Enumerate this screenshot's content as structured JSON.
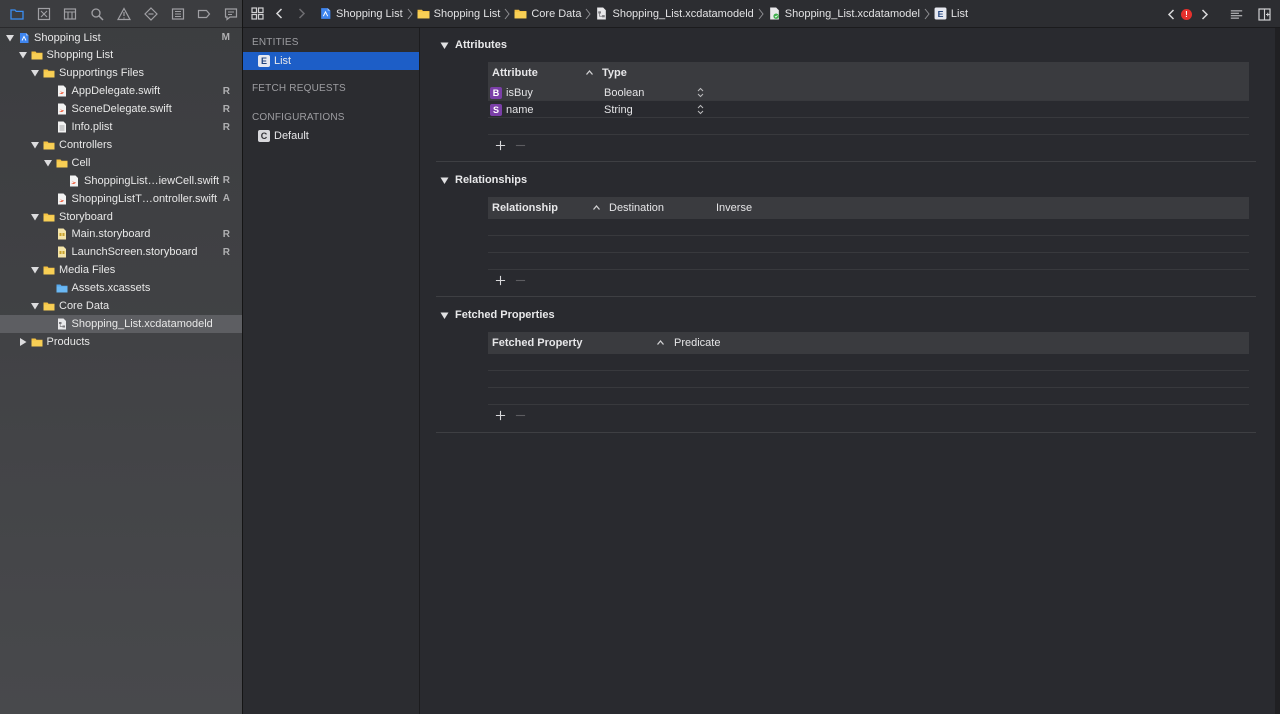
{
  "navigator": {
    "tools": [
      "folder-icon",
      "source-control-icon",
      "symbol-icon",
      "find-icon",
      "issue-icon",
      "test-icon",
      "debug-icon",
      "breakpoint-icon",
      "report-icon"
    ],
    "rows": [
      {
        "label": "Shopping List",
        "status": "M",
        "icon": "project-icon",
        "depth": 0,
        "open": true
      },
      {
        "label": "Shopping List",
        "status": "",
        "icon": "folder-icon",
        "depth": 1,
        "open": true
      },
      {
        "label": "Supportings Files",
        "status": "",
        "icon": "folder-icon",
        "depth": 2,
        "open": true
      },
      {
        "label": "AppDelegate.swift",
        "status": "R",
        "icon": "swift-file-icon",
        "depth": 3,
        "open": null
      },
      {
        "label": "SceneDelegate.swift",
        "status": "R",
        "icon": "swift-file-icon",
        "depth": 3,
        "open": null
      },
      {
        "label": "Info.plist",
        "status": "R",
        "icon": "plist-file-icon",
        "depth": 3,
        "open": null
      },
      {
        "label": "Controllers",
        "status": "",
        "icon": "folder-icon",
        "depth": 2,
        "open": true
      },
      {
        "label": "Cell",
        "status": "",
        "icon": "folder-icon",
        "depth": 3,
        "open": true
      },
      {
        "label": "ShoppingList…iewCell.swift",
        "status": "R",
        "icon": "swift-file-icon",
        "depth": 4,
        "open": null
      },
      {
        "label": "ShoppingListT…ontroller.swift",
        "status": "A",
        "icon": "swift-file-icon",
        "depth": 3,
        "open": null
      },
      {
        "label": "Storyboard",
        "status": "",
        "icon": "folder-icon",
        "depth": 2,
        "open": true
      },
      {
        "label": "Main.storyboard",
        "status": "R",
        "icon": "storyboard-file-icon",
        "depth": 3,
        "open": null
      },
      {
        "label": "LaunchScreen.storyboard",
        "status": "R",
        "icon": "storyboard-file-icon",
        "depth": 3,
        "open": null
      },
      {
        "label": "Media Files",
        "status": "",
        "icon": "folder-icon",
        "depth": 2,
        "open": true
      },
      {
        "label": "Assets.xcassets",
        "status": "",
        "icon": "asset-folder-icon",
        "depth": 3,
        "open": null
      },
      {
        "label": "Core Data",
        "status": "",
        "icon": "folder-icon",
        "depth": 2,
        "open": true
      },
      {
        "label": "Shopping_List.xcdatamodeld",
        "status": "",
        "icon": "datamodel-file-icon",
        "depth": 3,
        "open": null,
        "selected": true
      },
      {
        "label": "Products",
        "status": "",
        "icon": "folder-icon",
        "depth": 1,
        "open": false
      }
    ]
  },
  "jumpbar": {
    "crumbs": [
      {
        "label": "Shopping List",
        "icon": "project-icon"
      },
      {
        "label": "Shopping List",
        "icon": "folder-icon"
      },
      {
        "label": "Core Data",
        "icon": "folder-icon"
      },
      {
        "label": "Shopping_List.xcdatamodeld",
        "icon": "datamodel-file-icon"
      },
      {
        "label": "Shopping_List.xcdatamodel",
        "icon": "datamodel-version-icon"
      },
      {
        "label": "List",
        "icon": "entity-icon"
      }
    ],
    "issue_count": "!"
  },
  "entities_pane": {
    "entities_header": "ENTITIES",
    "entity": {
      "badge": "E",
      "label": "List"
    },
    "fetch_header": "FETCH REQUESTS",
    "config_header": "CONFIGURATIONS",
    "config": {
      "badge": "C",
      "label": "Default"
    }
  },
  "attributes": {
    "title": "Attributes",
    "col_attribute": "Attribute",
    "col_type": "Type",
    "rows": [
      {
        "badge": "B",
        "name": "isBuy",
        "type": "Boolean"
      },
      {
        "badge": "S",
        "name": "name",
        "type": "String"
      }
    ]
  },
  "relationships": {
    "title": "Relationships",
    "col_relationship": "Relationship",
    "col_destination": "Destination",
    "col_inverse": "Inverse"
  },
  "fetched": {
    "title": "Fetched Properties",
    "col_property": "Fetched Property",
    "col_predicate": "Predicate"
  },
  "colors": {
    "selection": "#1d5ec7",
    "attr_badge": "#7b3fa8",
    "issue": "#e6302c",
    "folder": "#f5c242"
  }
}
